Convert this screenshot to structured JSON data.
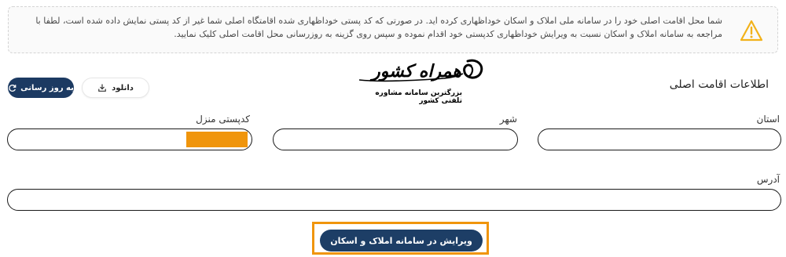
{
  "notice": {
    "icon": "warning-icon",
    "text": "شما محل اقامت اصلی خود را در سامانه ملی املاک و اسکان خوداظهاری کرده اید. در صورتی که کد پستی خوداظهاری شده اقامتگاه اصلی شما غیر از کد پستی نمایش داده شده است، لطفا با مراجعه به سامانه املاک و اسکان نسبت به ویرایش خوداظهاری کدپستی خود اقدام نموده و سپس روی گزینه به روزرسانی محل اقامت اصلی کلیک نمایید.",
    "accent_color": "#f2b21b"
  },
  "section": {
    "title": "اطلاعات اقامت اصلی"
  },
  "toolbar": {
    "update_label": "به روز رسانی",
    "update_icon": "refresh-icon",
    "download_label": "دانلود",
    "download_icon": "download-icon"
  },
  "watermark": {
    "brand": "همراه کشور",
    "tagline": "بزرگترین سامانه مشاوره تلفنی کشور"
  },
  "fields": {
    "province": {
      "label": "استان",
      "value": ""
    },
    "city": {
      "label": "شهر",
      "value": ""
    },
    "postal_code": {
      "label": "کدپستی منزل",
      "value": ""
    },
    "address": {
      "label": "آدرس",
      "value": ""
    }
  },
  "actions": {
    "edit_label": "ویرایش در سامانه املاک و اسکان"
  },
  "colors": {
    "primary": "#1c3a62",
    "highlight": "#f0950c",
    "border": "#1a1a1a"
  }
}
